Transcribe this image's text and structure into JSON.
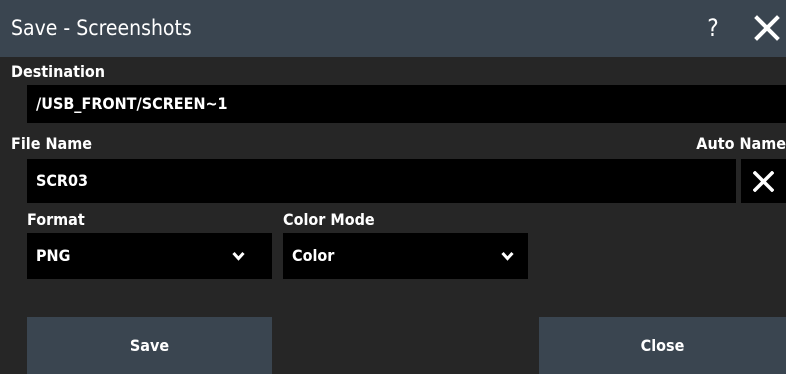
{
  "dialog": {
    "title": "Save - Screenshots",
    "help_glyph": "?",
    "help_icon": "question-mark-icon",
    "close_icon": "close-icon"
  },
  "destination": {
    "label": "Destination",
    "value": "/USB_FRONT/SCREEN~1"
  },
  "file_name": {
    "label": "File Name",
    "value": "SCR03",
    "auto_name_label": "Auto Name",
    "clear_icon": "close-icon"
  },
  "format": {
    "label": "Format",
    "selected": "PNG",
    "icon": "chevron-down-icon"
  },
  "color_mode": {
    "label": "Color Mode",
    "selected": "Color",
    "icon": "chevron-down-icon"
  },
  "buttons": {
    "save_label": "Save",
    "close_label": "Close"
  },
  "colors": {
    "title_bar": "#3a4550",
    "dialog_background": "#262626",
    "field_background": "#000000",
    "button_background": "#3a4550",
    "text": "#ffffff"
  }
}
